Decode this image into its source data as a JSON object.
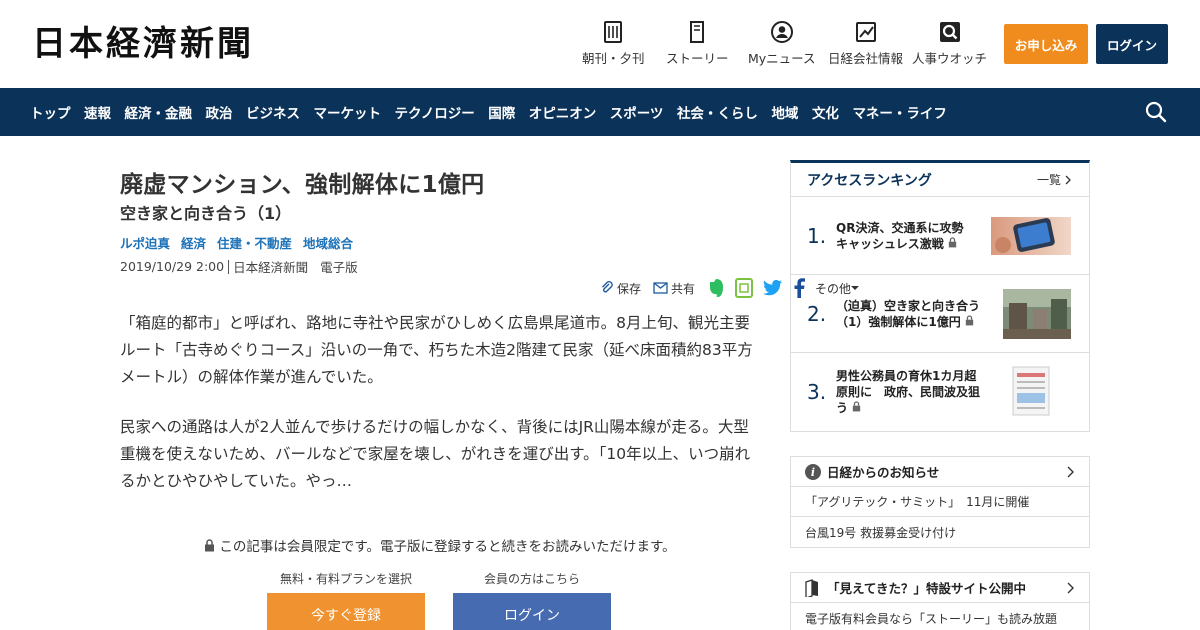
{
  "header": {
    "logo": "日本経濟新聞",
    "nav": [
      {
        "label": "朝刊・夕刊",
        "icon": "newspaper-icon"
      },
      {
        "label": "ストーリー",
        "icon": "book-icon"
      },
      {
        "label": "Myニュース",
        "icon": "user-icon"
      },
      {
        "label": "日経会社情報",
        "icon": "chart-icon"
      },
      {
        "label": "人事ウオッチ",
        "icon": "magnifier-icon"
      }
    ],
    "apply_label": "お申し込み",
    "login_label": "ログイン"
  },
  "categories": [
    "トップ",
    "速報",
    "経済・金融",
    "政治",
    "ビジネス",
    "マーケット",
    "テクノロジー",
    "国際",
    "オピニオン",
    "スポーツ",
    "社会・くらし",
    "地域",
    "文化",
    "マネー・ライフ"
  ],
  "article": {
    "title": "廃虚マンション、強制解体に1億円",
    "subtitle": "空き家と向き合う（1）",
    "tags": [
      "ルポ迫真",
      "経済",
      "住建・不動産",
      "地域総合"
    ],
    "date": "2019/10/29 2:00",
    "source": "日本経済新聞",
    "edition": "電子版",
    "share": {
      "save": "保存",
      "share": "共有",
      "more": "その他"
    },
    "paragraphs": [
      "「箱庭的都市」と呼ばれ、路地に寺社や民家がひしめく広島県尾道市。8月上旬、観光主要ルート「古寺めぐりコース」沿いの一角で、朽ちた木造2階建て民家（延べ床面積約83平方メートル）の解体作業が進んでいた。",
      "民家への通路は人が2人並んで歩けるだけの幅しかなく、背後にはJR山陽本線が走る。大型重機を使えないため、バールなどで家屋を壊し、がれきを運び出す。「10年以上、いつ崩れるかとひやひやしていた。やっ…"
    ]
  },
  "paywall": {
    "note": "この記事は会員限定です。電子版に登録すると続きをお読みいただけます。",
    "plan_label": "無料・有料プランを選択",
    "member_label": "会員の方はこちら",
    "register_button": "今すぐ登録",
    "login_button": "ログイン"
  },
  "ranking": {
    "title": "アクセスランキング",
    "all_label": "一覧",
    "items": [
      {
        "rank": "1.",
        "text": "QR決済、交通系に攻勢　キャッシュレス激戦"
      },
      {
        "rank": "2.",
        "text": "（迫真）空き家と向き合う（1）強制解体に1億円"
      },
      {
        "rank": "3.",
        "text": "男性公務員の育休1カ月超原則に　政府、民間波及狙う"
      }
    ]
  },
  "notices": {
    "title": "日経からのお知らせ",
    "items": [
      "「アグリテック・サミット」　11月に開催",
      "台風19号 救援募金受け付け"
    ]
  },
  "promo": {
    "title": "「見えてきた？」特設サイト公開中",
    "text": "電子版有料会員なら「ストーリー」も読み放題"
  },
  "colors": {
    "navy": "#0b3259",
    "orange": "#f08c1e",
    "link_blue": "#1d72b8",
    "register_orange": "#f0922f",
    "login_blue": "#466bb0"
  }
}
